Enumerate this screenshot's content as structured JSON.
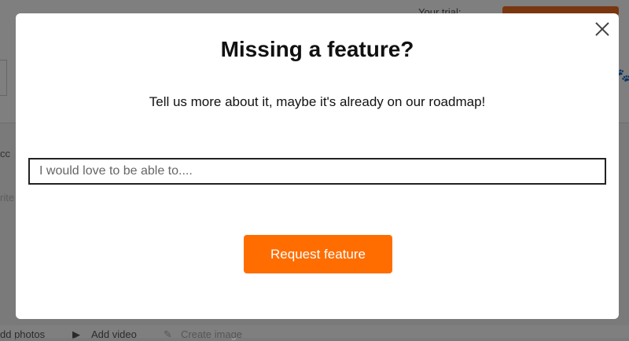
{
  "background": {
    "trial_label": "Your trial:",
    "sidebar_text_1": "cc",
    "sidebar_text_2": "rite",
    "footer": {
      "add_photos": "dd photos",
      "add_video": "Add video",
      "create_image": "Create image"
    }
  },
  "modal": {
    "title": "Missing a feature?",
    "subtitle": "Tell us more about it, maybe it's already on our roadmap!",
    "input": {
      "placeholder": "I would love to be able to....",
      "value": ""
    },
    "submit_label": "Request feature",
    "close_icon": "close-icon"
  },
  "colors": {
    "accent": "#ff6d00",
    "overlay": "rgba(0,0,0,0.5)"
  }
}
